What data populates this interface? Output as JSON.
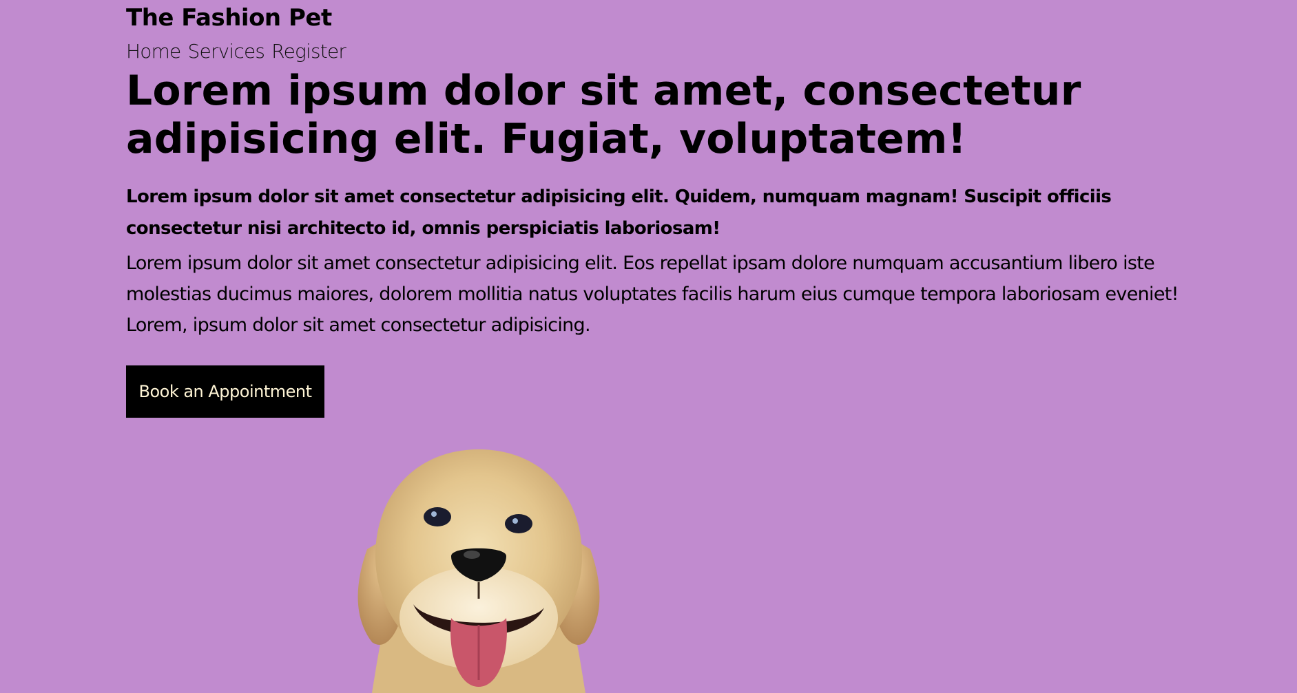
{
  "brand": {
    "name": "The Fashion Pet"
  },
  "nav": {
    "items": [
      {
        "label": "Home"
      },
      {
        "label": "Services"
      },
      {
        "label": "Register"
      }
    ]
  },
  "hero": {
    "headline": "Lorem ipsum dolor sit amet, consectetur adipisicing elit. Fugiat, voluptatem!",
    "lead": "Lorem ipsum dolor sit amet consectetur adipisicing elit. Quidem, numquam magnam! Suscipit officiis consectetur nisi architecto id, omnis perspiciatis laboriosam!",
    "body": "Lorem ipsum dolor sit amet consectetur adipisicing elit. Eos repellat ipsam dolore numquam accusantium libero iste molestias ducimus maiores, dolorem mollitia natus voluptates facilis harum eius cumque tempora laboriosam eveniet! Lorem, ipsum dolor sit amet consectetur adipisicing.",
    "cta_label": "Book an Appointment"
  },
  "colors": {
    "background": "#c18bcf",
    "button_bg": "#000000",
    "button_text": "#fff5d6"
  },
  "image": {
    "semantic": "puppy-image"
  }
}
